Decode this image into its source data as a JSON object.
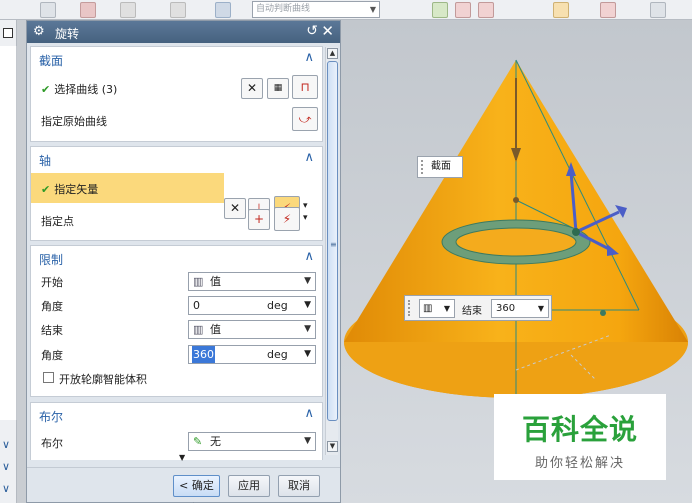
{
  "toolbar": {
    "snap_combo": "自动判断曲线",
    "icons": [
      "snap-icon",
      "face-icon",
      "point-icon",
      "curve-icon",
      "select-icon"
    ]
  },
  "dialog": {
    "title": "旋转",
    "sections": {
      "section_curve": {
        "title": "截面",
        "select_curve_label": "选择曲线 (3)",
        "specify_origin_curve_label": "指定原始曲线"
      },
      "axis": {
        "title": "轴",
        "specify_vector_label": "指定矢量",
        "specify_point_label": "指定点"
      },
      "limits": {
        "title": "限制",
        "start_label": "开始",
        "start_value": "值",
        "start_angle_label": "角度",
        "start_angle_value": "0",
        "start_angle_unit": "deg",
        "end_label": "结束",
        "end_value": "值",
        "end_angle_label": "角度",
        "end_angle_value": "360",
        "end_angle_unit": "deg",
        "open_profile_label": "开放轮廓智能体积"
      },
      "boolean": {
        "title": "布尔",
        "boolean_label": "布尔",
        "boolean_value": "无"
      }
    },
    "buttons": {
      "ok": "< 确定 >",
      "apply": "应用",
      "cancel": "取消"
    }
  },
  "viewport": {
    "section_tip": "截面",
    "end_tip_label": "结束",
    "end_tip_value": "360",
    "end_tip_mode_icon": "value-icon"
  },
  "watermark": {
    "title": "百科全说",
    "subtitle": "助你轻松解决"
  },
  "colors": {
    "cone": "#f5a60f",
    "section_blue": "#2a62a8",
    "highlight": "#fbd97c",
    "watermark_green": "#2aa13b"
  }
}
